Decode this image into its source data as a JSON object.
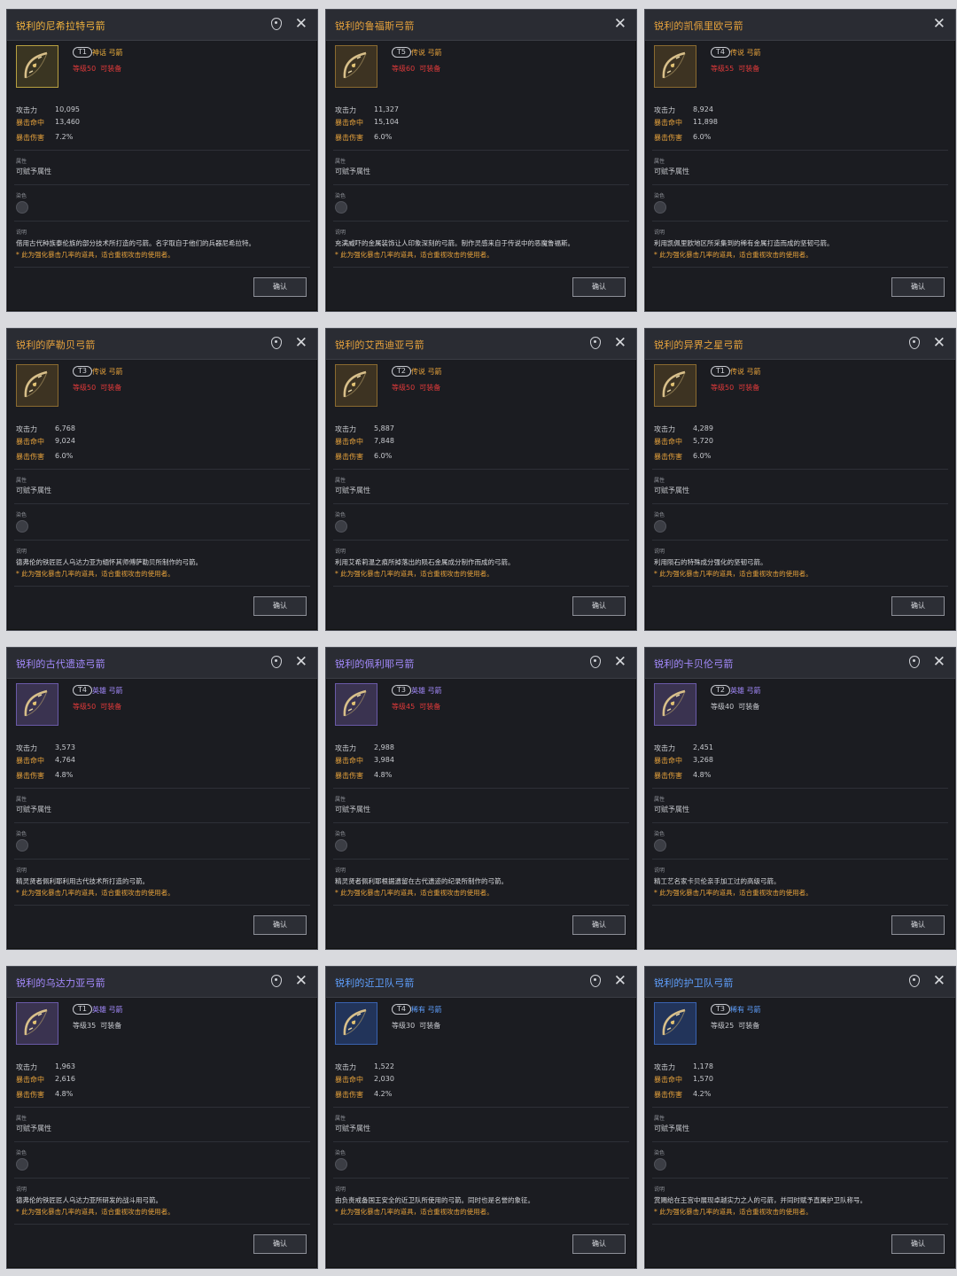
{
  "labels": {
    "attack": "攻击力",
    "crit_hit": "暴击命中",
    "crit_dmg": "暴击伤害",
    "attribute_label": "属性",
    "attribute_value": "可赋予属性",
    "dye_label": "染色",
    "desc_label": "说明",
    "confirm": "确认"
  },
  "icons": {
    "pin": "map-pin-icon",
    "close": "close-x-icon"
  },
  "colors": {
    "mythic": "#f2b33d",
    "legendary": "#e8a33c",
    "hero": "#a58bff",
    "rare": "#5fa0ff",
    "requirement_unmet": "#e03a3a"
  },
  "cards": [
    {
      "title": "锐利的尼希拉特弓箭",
      "tier": "T1",
      "rarity": "神话 弓箭",
      "rarity_key": "mythic",
      "level_req": "等级50",
      "equip": "可装备",
      "req_met": false,
      "attack": "10,095",
      "crit_hit": "13,460",
      "crit_dmg": "7.2%",
      "description": "借用古代种族泰伦族的部分技术所打造的弓箭。名字取自于他们的兵器尼希拉特。",
      "note": "* 此为强化暴击几率的道具，适合重视攻击的使用者。"
    },
    {
      "title": "锐利的鲁福斯弓箭",
      "tier": "T5",
      "rarity": "传说 弓箭",
      "rarity_key": "legendary",
      "level_req": "等级60",
      "equip": "可装备",
      "req_met": false,
      "attack": "11,327",
      "crit_hit": "15,104",
      "crit_dmg": "6.0%",
      "description": "充满威吓的金属装饰让人印象深刻的弓箭。制作灵感来自于传说中的恶魔鲁福斯。",
      "note": "* 此为强化暴击几率的道具，适合重视攻击的使用者。"
    },
    {
      "title": "锐利的凯佩里欧弓箭",
      "tier": "T4",
      "rarity": "传说 弓箭",
      "rarity_key": "legendary",
      "level_req": "等级55",
      "equip": "可装备",
      "req_met": false,
      "attack": "8,924",
      "crit_hit": "11,898",
      "crit_dmg": "6.0%",
      "description": "利用凯佩里欧地区所采集到的稀有金属打造而成的坚韧弓箭。",
      "note": "* 此为强化暴击几率的道具，适合重视攻击的使用者。"
    },
    {
      "title": "锐利的萨勒贝弓箭",
      "tier": "T3",
      "rarity": "传说 弓箭",
      "rarity_key": "legendary",
      "level_req": "等级50",
      "equip": "可装备",
      "req_met": false,
      "attack": "6,768",
      "crit_hit": "9,024",
      "crit_dmg": "6.0%",
      "description": "德弗伦的铁匠匠人乌达力亚为缅怀其师傅萨勒贝所制作的弓箭。",
      "note": "* 此为强化暴击几率的道具，适合重视攻击的使用者。"
    },
    {
      "title": "锐利的艾西迪亚弓箭",
      "tier": "T2",
      "rarity": "传说 弓箭",
      "rarity_key": "legendary",
      "level_req": "等级50",
      "equip": "可装备",
      "req_met": false,
      "attack": "5,887",
      "crit_hit": "7,848",
      "crit_dmg": "6.0%",
      "description": "利用艾希莉温之痕所掉落出的陨石金属成分制作而成的弓箭。",
      "note": "* 此为强化暴击几率的道具，适合重视攻击的使用者。"
    },
    {
      "title": "锐利的异界之星弓箭",
      "tier": "T1",
      "rarity": "传说 弓箭",
      "rarity_key": "legendary",
      "level_req": "等级50",
      "equip": "可装备",
      "req_met": false,
      "attack": "4,289",
      "crit_hit": "5,720",
      "crit_dmg": "6.0%",
      "description": "利用陨石的特殊成分强化的坚韧弓箭。",
      "note": "* 此为强化暴击几率的道具，适合重视攻击的使用者。"
    },
    {
      "title": "锐利的古代遗迹弓箭",
      "tier": "T4",
      "rarity": "英雄 弓箭",
      "rarity_key": "hero",
      "level_req": "等级50",
      "equip": "可装备",
      "req_met": false,
      "attack": "3,573",
      "crit_hit": "4,764",
      "crit_dmg": "4.8%",
      "description": "精灵贤者佩利耶利用古代技术所打造的弓箭。",
      "note": "* 此为强化暴击几率的道具，适合重视攻击的使用者。"
    },
    {
      "title": "锐利的佩利耶弓箭",
      "tier": "T3",
      "rarity": "英雄 弓箭",
      "rarity_key": "hero",
      "level_req": "等级45",
      "equip": "可装备",
      "req_met": false,
      "attack": "2,988",
      "crit_hit": "3,984",
      "crit_dmg": "4.8%",
      "description": "精灵贤者佩利耶根据遗留在古代遗迹的纪录所制作的弓箭。",
      "note": "* 此为强化暴击几率的道具，适合重视攻击的使用者。"
    },
    {
      "title": "锐利的卡贝伦弓箭",
      "tier": "T2",
      "rarity": "英雄 弓箭",
      "rarity_key": "hero",
      "level_req": "等级40",
      "equip": "可装备",
      "req_met": true,
      "attack": "2,451",
      "crit_hit": "3,268",
      "crit_dmg": "4.8%",
      "description": "精工艺名家卡贝伦亲手加工过的高级弓箭。",
      "note": "* 此为强化暴击几率的道具，适合重视攻击的使用者。"
    },
    {
      "title": "锐利的乌达力亚弓箭",
      "tier": "T1",
      "rarity": "英雄 弓箭",
      "rarity_key": "hero",
      "level_req": "等级35",
      "equip": "可装备",
      "req_met": true,
      "attack": "1,963",
      "crit_hit": "2,616",
      "crit_dmg": "4.8%",
      "description": "德弗伦的铁匠匠人乌达力亚所研发的战斗用弓箭。",
      "note": "* 此为强化暴击几率的道具，适合重视攻击的使用者。"
    },
    {
      "title": "锐利的近卫队弓箭",
      "tier": "T4",
      "rarity": "稀有 弓箭",
      "rarity_key": "rare",
      "level_req": "等级30",
      "equip": "可装备",
      "req_met": true,
      "attack": "1,522",
      "crit_hit": "2,030",
      "crit_dmg": "4.2%",
      "description": "由负责戒备国王安全的近卫队所使用的弓箭。同时也是名誉的象征。",
      "note": "* 此为强化暴击几率的道具，适合重视攻击的使用者。"
    },
    {
      "title": "锐利的护卫队弓箭",
      "tier": "T3",
      "rarity": "稀有 弓箭",
      "rarity_key": "rare",
      "level_req": "等级25",
      "equip": "可装备",
      "req_met": true,
      "attack": "1,178",
      "crit_hit": "1,570",
      "crit_dmg": "4.2%",
      "description": "赏赐给在王宫中展现卓越实力之人的弓箭，并同时赋予直属护卫队称号。",
      "note": "* 此为强化暴击几率的道具，适合重视攻击的使用者。"
    }
  ]
}
